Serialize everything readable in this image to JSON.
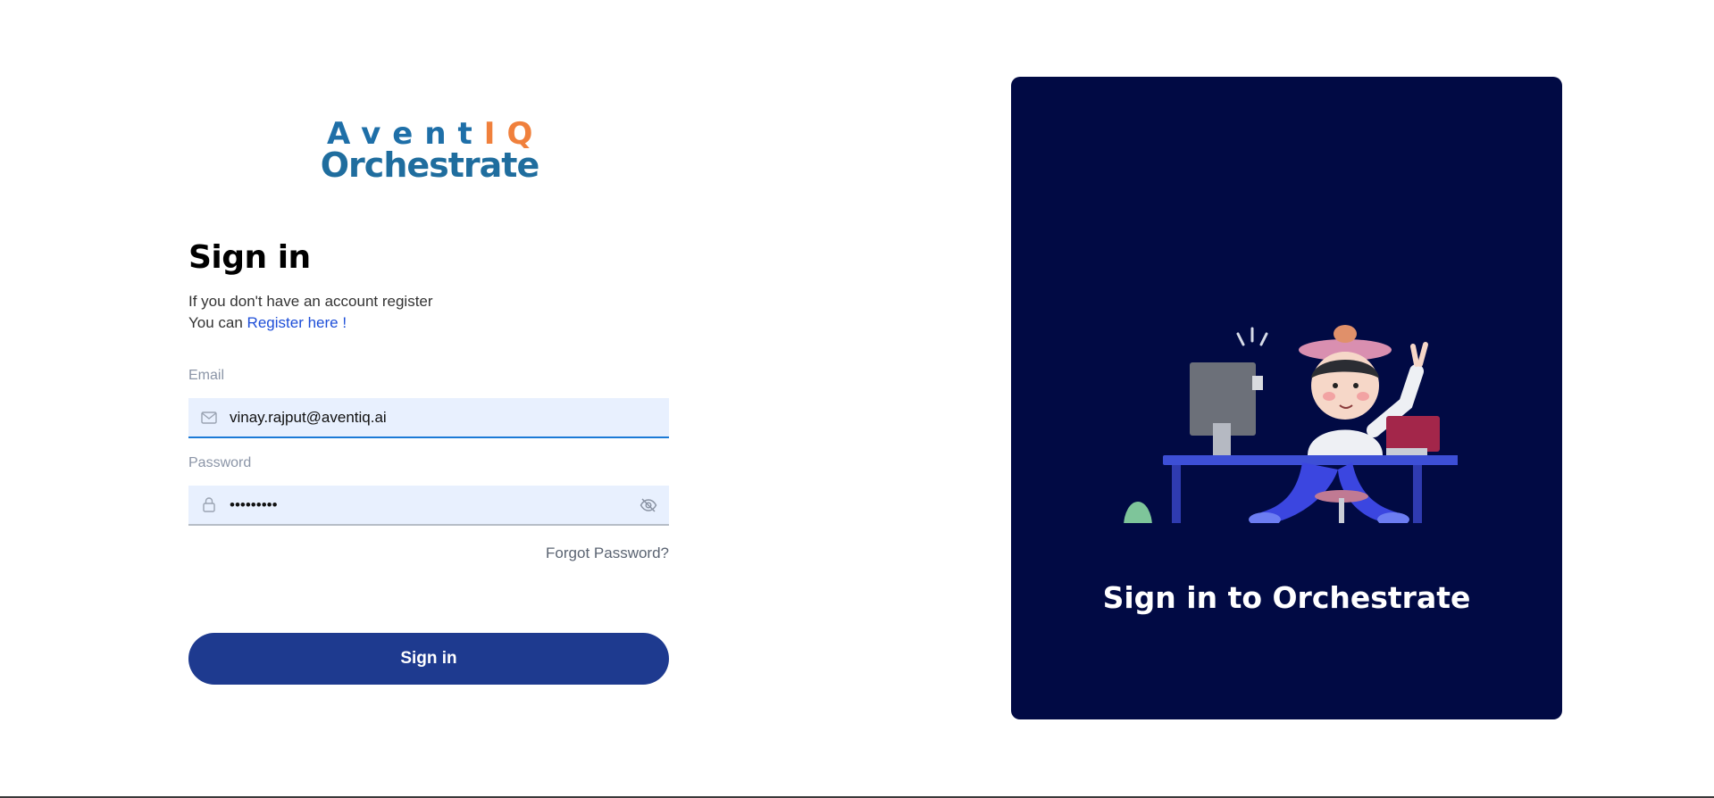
{
  "logo": {
    "line1_main": "Avent",
    "line1_accent": "IQ",
    "line2": "Orchestrate"
  },
  "signin": {
    "title": "Sign in",
    "subtitle": "If you don't have an account register",
    "register_prefix": "You can ",
    "register_link": "Register here !"
  },
  "email": {
    "label": "Email",
    "value": "vinay.rajput@aventiq.ai",
    "icon": "mail-icon"
  },
  "password": {
    "label": "Password",
    "value": "•••••••••",
    "icon": "lock-icon",
    "toggle_icon": "eye-off-icon"
  },
  "forgot": "Forgot Password?",
  "button": "Sign in",
  "panel": {
    "title": "Sign in to Orchestrate",
    "background": "#010a44"
  },
  "colors": {
    "accent": "#1e3a8f",
    "link": "#1d4ed8",
    "logo_blue": "#1f6d9e",
    "logo_orange": "#f0803c"
  }
}
